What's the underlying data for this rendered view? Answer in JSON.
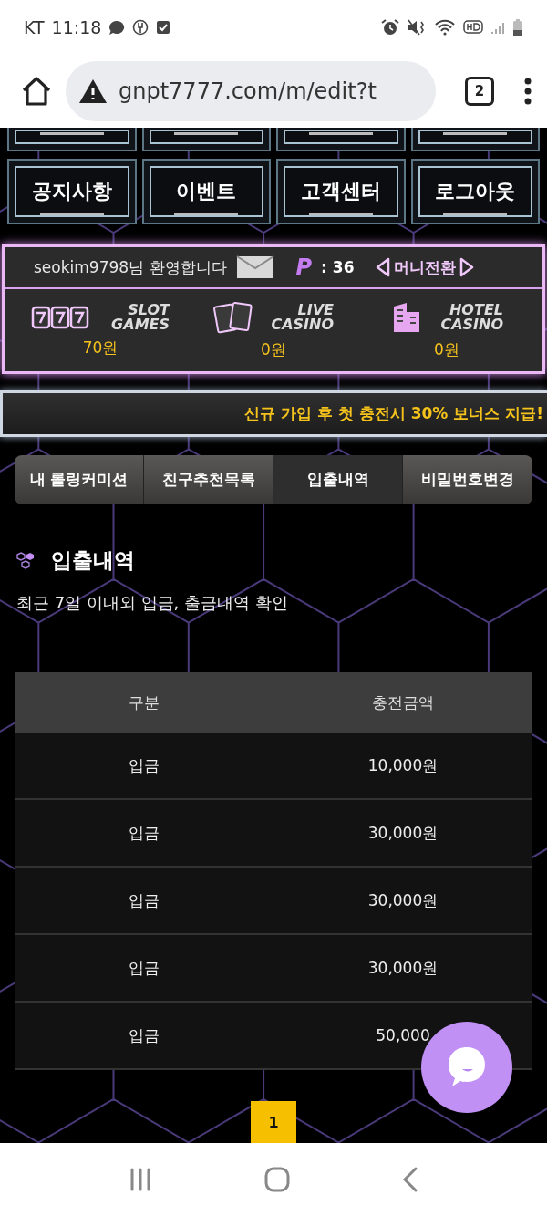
{
  "status_bar": {
    "carrier": "KT",
    "time": "11:18"
  },
  "browser": {
    "url": "gnpt7777.com/m/edit?t",
    "tab_count": "2"
  },
  "menu": [
    {
      "label": "공지사항"
    },
    {
      "label": "이벤트"
    },
    {
      "label": "고객센터"
    },
    {
      "label": "로그아웃"
    }
  ],
  "account": {
    "welcome": "seokim9798님 환영합니다",
    "points_label": "P",
    "points": ": 36",
    "exchange": "머니전환",
    "wallets": [
      {
        "kind": "slot",
        "label": "SLOT GAMES",
        "amount": "70원"
      },
      {
        "kind": "live",
        "label": "LIVE CASINO",
        "amount": "0원"
      },
      {
        "kind": "hotel",
        "label": "HOTEL CASINO",
        "amount": "0원"
      }
    ]
  },
  "banner": "신규 가입 후 첫 충전시 30% 보너스 지급!",
  "tabs": [
    {
      "label": "내 롤링커미션",
      "selected": false
    },
    {
      "label": "친구추천목록",
      "selected": false
    },
    {
      "label": "입출내역",
      "selected": true
    },
    {
      "label": "비밀번호변경",
      "selected": false
    }
  ],
  "section": {
    "title": "입출내역",
    "subtitle": "최근 7일 이내외 입금, 출금내역 확인"
  },
  "table": {
    "columns": [
      "구분",
      "충전금액"
    ],
    "rows": [
      [
        "입금",
        "10,000원"
      ],
      [
        "입금",
        "30,000원"
      ],
      [
        "입금",
        "30,000원"
      ],
      [
        "입금",
        "30,000원"
      ],
      [
        "입금",
        "50,000"
      ]
    ]
  },
  "pagination": [
    {
      "label": "1",
      "selected": true
    }
  ]
}
